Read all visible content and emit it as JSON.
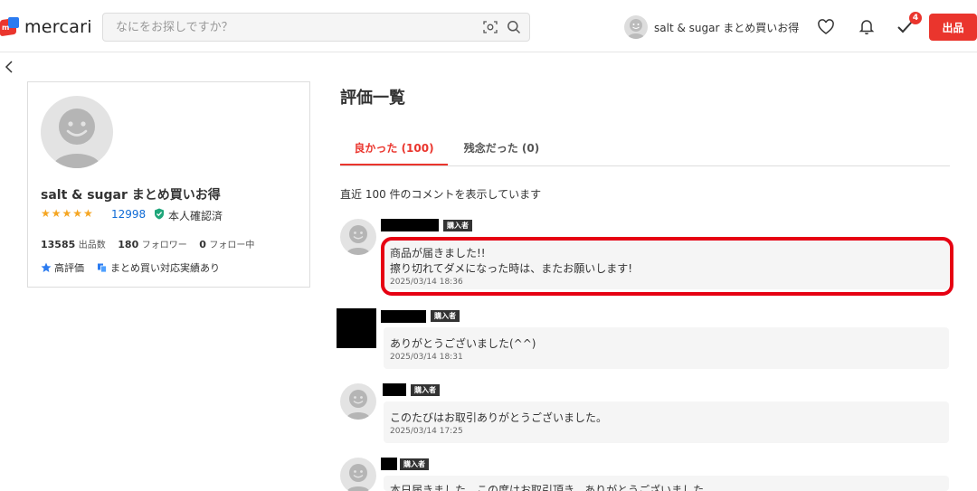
{
  "header": {
    "logo_text": "mercari",
    "search_placeholder": "なにをお探しですか？",
    "user_name": "salt & sugar まとめ買いお得",
    "notification_badge": "4",
    "sell_label": "出品"
  },
  "profile": {
    "name": "salt & sugar まとめ買いお得",
    "stars": "★★★★★",
    "rating_count": "12998",
    "verified_label": "本人確認済",
    "listings_count": "13585",
    "listings_label": "出品数",
    "followers_count": "180",
    "followers_label": "フォロワー",
    "following_count": "0",
    "following_label": "フォロー中",
    "tags": [
      "高評価",
      "まとめ買い対応実績あり"
    ]
  },
  "main": {
    "title": "評価一覧",
    "tabs": [
      {
        "label": "良かった (100)",
        "active": true
      },
      {
        "label": "残念だった (0)",
        "active": false
      }
    ],
    "showing_text": "直近 100 件のコメントを表示しています"
  },
  "reviews": [
    {
      "tag": "購入者",
      "lines": [
        "商品が届きました!!",
        "擦り切れてダメになった時は、またお願いします!"
      ],
      "date": "2025/03/14 18:36"
    },
    {
      "tag": "購入者",
      "lines": [
        "ありがとうございました(^^)"
      ],
      "date": "2025/03/14 18:31"
    },
    {
      "tag": "購入者",
      "lines": [
        "このたびはお取引ありがとうございました。"
      ],
      "date": "2025/03/14 17:25"
    },
    {
      "tag": "購入者",
      "lines": [
        "本日届きました。この度はお取引頂き、ありがとうございました"
      ],
      "date": ""
    }
  ],
  "colors": {
    "brand_red": "#ea352d",
    "link_blue": "#0f6bd6",
    "star_gold": "#f5a623",
    "verified_green": "#1fa67a",
    "highlight_red": "#e60012"
  }
}
